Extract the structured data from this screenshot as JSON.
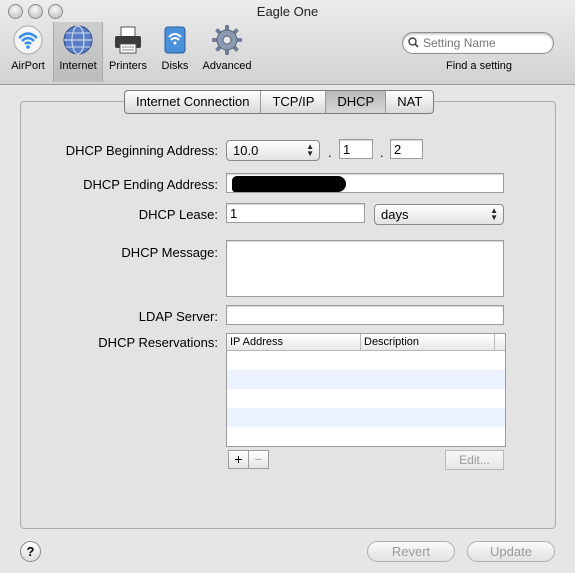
{
  "window": {
    "title": "Eagle One"
  },
  "toolbar": {
    "items": [
      {
        "label": "AirPort"
      },
      {
        "label": "Internet"
      },
      {
        "label": "Printers"
      },
      {
        "label": "Disks"
      },
      {
        "label": "Advanced"
      }
    ],
    "selected": "Internet",
    "search": {
      "placeholder": "Setting Name",
      "caption": "Find a setting"
    }
  },
  "tabs": [
    {
      "label": "Internet Connection"
    },
    {
      "label": "TCP/IP"
    },
    {
      "label": "DHCP"
    },
    {
      "label": "NAT"
    }
  ],
  "selected_tab": "DHCP",
  "form": {
    "begin_label": "DHCP Beginning Address:",
    "begin_popup": "10.0",
    "begin_octet3": "1",
    "begin_octet4": "2",
    "dot": ".",
    "end_label": "DHCP Ending Address:",
    "lease_label": "DHCP Lease:",
    "lease_value": "1",
    "lease_unit": "days",
    "message_label": "DHCP Message:",
    "message_value": "",
    "ldap_label": "LDAP Server:",
    "ldap_value": "",
    "reservations_label": "DHCP Reservations:",
    "columns": [
      "IP Address",
      "Description"
    ]
  },
  "buttons": {
    "add": "+",
    "remove": "−",
    "edit": "Edit...",
    "revert": "Revert",
    "update": "Update",
    "help": "?"
  },
  "icons": {
    "airport": "airport-wifi-icon",
    "internet": "globe-icon",
    "printers": "printer-icon",
    "disks": "disk-icon",
    "advanced": "gear-icon"
  }
}
